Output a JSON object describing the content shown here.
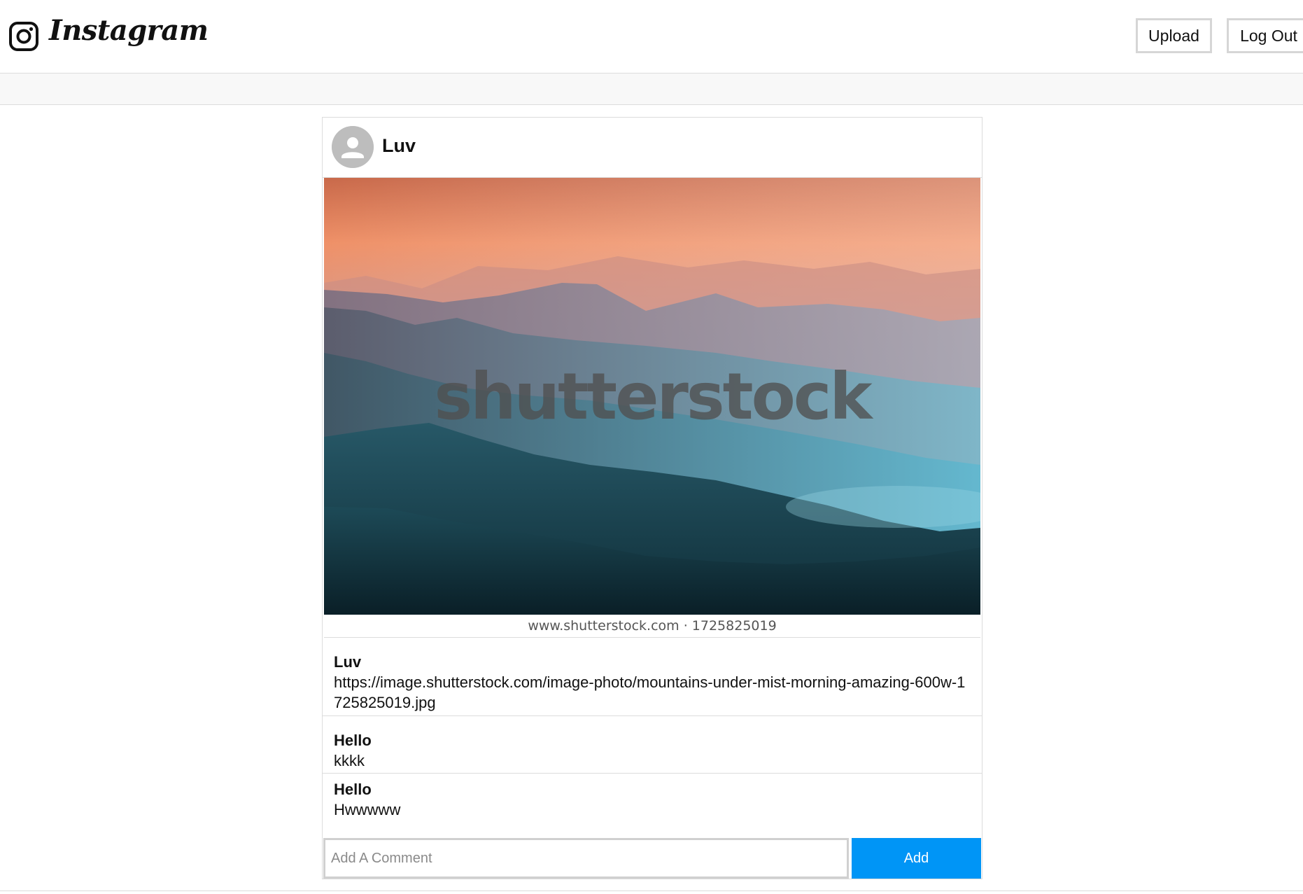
{
  "header": {
    "logo_text": "Instagram",
    "upload_label": "Upload",
    "logout_label": "Log Out"
  },
  "post": {
    "username": "Luv",
    "image": {
      "watermark": "shutterstock",
      "credit": "www.shutterstock.com · 1725825019"
    },
    "caption": {
      "username": "Luv",
      "text": "https://image.shutterstock.com/image-photo/mountains-under-mist-morning-amazing-600w-1725825019.jpg"
    },
    "comments": [
      {
        "username": "Hello",
        "text": "kkkk"
      },
      {
        "username": "Hello",
        "text": "Hwwwww"
      }
    ],
    "comment_form": {
      "placeholder": "Add A Comment",
      "button_label": "Add",
      "button_color": "#0095f6"
    }
  }
}
